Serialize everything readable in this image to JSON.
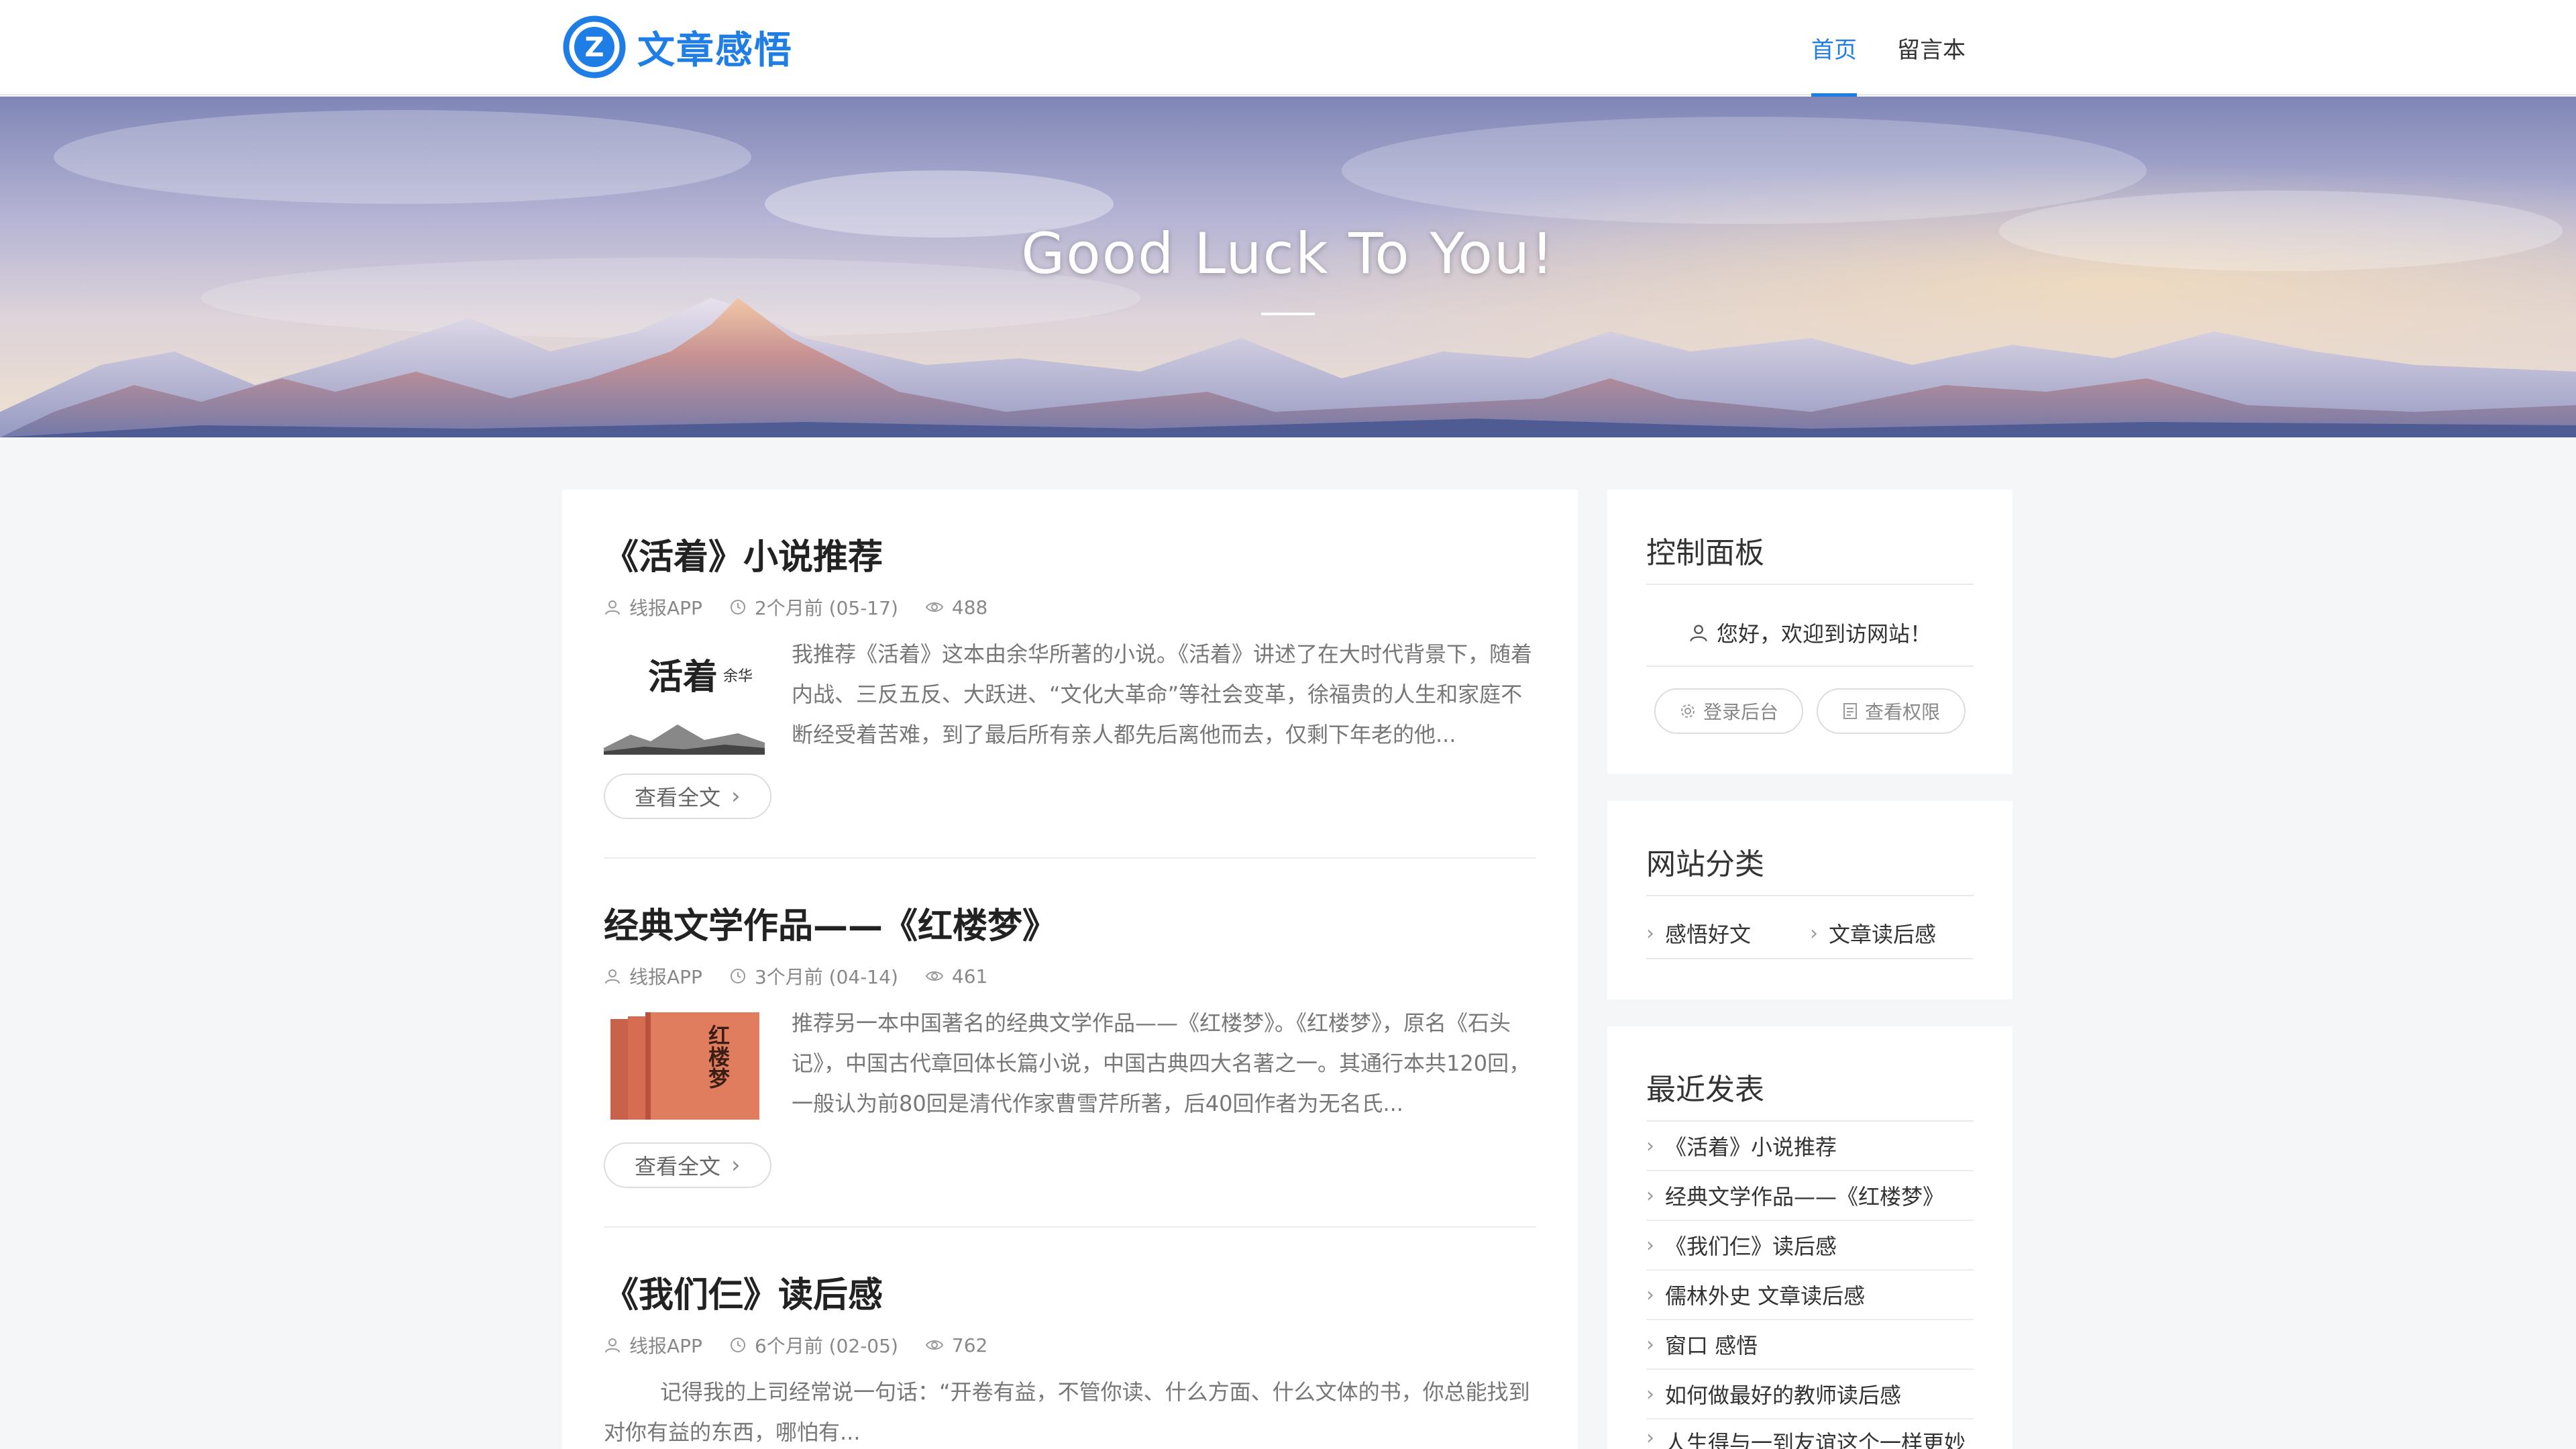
{
  "site": {
    "logo_letter": "Z",
    "name": "文章感悟",
    "brand_color": "#1e7ee6"
  },
  "nav": [
    {
      "label": "首页",
      "active": true
    },
    {
      "label": "留言本",
      "active": false
    }
  ],
  "banner": {
    "title": "Good Luck To You!"
  },
  "posts": [
    {
      "title": "《活着》小说推荐",
      "author": "线报APP",
      "date": "2个月前 (05-17)",
      "views": "488",
      "thumb_text": "活着",
      "thumb_author": "余华",
      "excerpt": "我推荐《活着》这本由余华所著的小说。《活着》讲述了在大时代背景下，随着内战、三反五反、大跃进、“文化大革命”等社会变革，徐福贵的人生和家庭不断经受着苦难，到了最后所有亲人都先后离他而去，仅剩下年老的他...",
      "read_more": "查看全文"
    },
    {
      "title": "经典文学作品——《红楼梦》",
      "author": "线报APP",
      "date": "3个月前 (04-14)",
      "views": "461",
      "thumb_text": "红楼梦",
      "excerpt": "推荐另一本中国著名的经典文学作品——《红楼梦》。《红楼梦》，原名《石头记》，中国古代章回体长篇小说，中国古典四大名著之一。其通行本共120回，一般认为前80回是清代作家曹雪芹所著，后40回作者为无名氏...",
      "read_more": "查看全文"
    },
    {
      "title": "《我们仨》读后感",
      "author": "线报APP",
      "date": "6个月前 (02-05)",
      "views": "762",
      "excerpt": "记得我的上司经常说一句话：“开卷有益，不管你读、什么方面、什么文体的书，你总能找到对你有益的东西，哪怕有..."
    }
  ],
  "sidebar": {
    "control": {
      "title": "控制面板",
      "welcome": "您好，欢迎到访网站！",
      "btn_login": "登录后台",
      "btn_perm": "查看权限"
    },
    "categories": {
      "title": "网站分类",
      "items": [
        "感悟好文",
        "文章读后感"
      ]
    },
    "recent": {
      "title": "最近发表",
      "items": [
        "《活着》小说推荐",
        "经典文学作品——《红楼梦》",
        "《我们仨》读后感",
        "儒林外史 文章读后感",
        "窗口 感悟",
        "如何做最好的教师读后感",
        "人生得与一到友谊这个一样更妙"
      ]
    }
  }
}
